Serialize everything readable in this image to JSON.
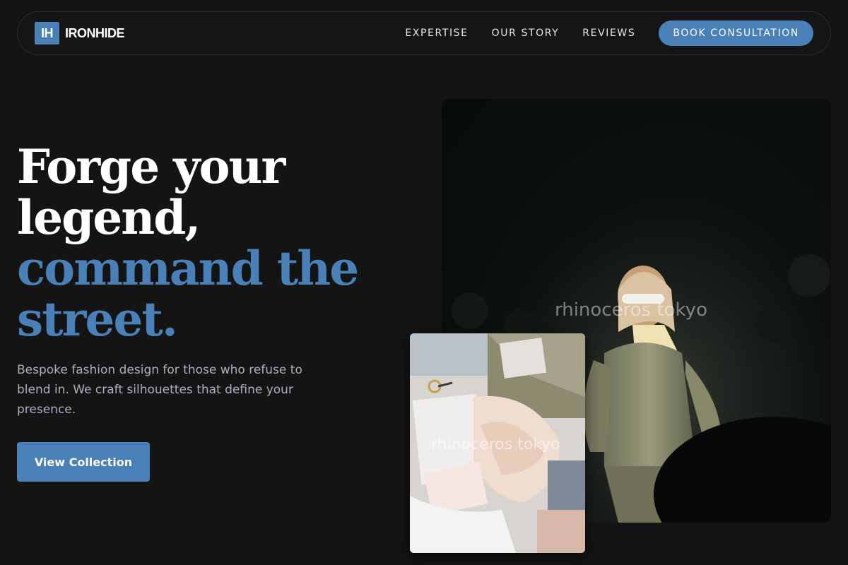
{
  "nav": {
    "logo_mark": "IH",
    "brand": "IRONHIDE",
    "links": [
      {
        "label": "EXPERTISE"
      },
      {
        "label": "OUR STORY"
      },
      {
        "label": "REVIEWS"
      }
    ],
    "cta_label": "BOOK CONSULTATION"
  },
  "hero": {
    "title_line1": "Forge your",
    "title_line2": "legend,",
    "title_accent1": "command the",
    "title_accent2": "street.",
    "subtitle": "Bespoke fashion design for those who refuse to blend in. We craft silhouettes that define your presence.",
    "button_label": "View Collection"
  },
  "images": {
    "main_watermark": "rhinoceros tokyo",
    "small_watermark": "rhinoceros tokyo"
  },
  "colors": {
    "background": "#141414",
    "accent": "#4a80b8",
    "subtext": "#aab0bd"
  }
}
